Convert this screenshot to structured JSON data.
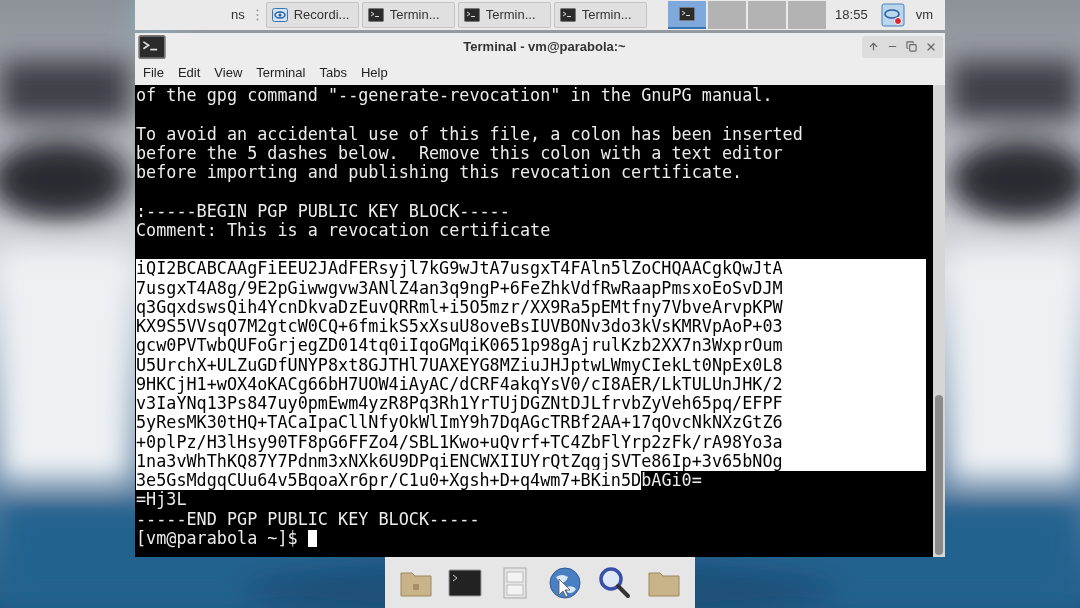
{
  "taskbar": {
    "overflow_label": "ns",
    "tasks": [
      {
        "kind": "recorder",
        "label": "Recordi..."
      },
      {
        "kind": "terminal",
        "label": "Termin..."
      },
      {
        "kind": "terminal",
        "label": "Termin..."
      },
      {
        "kind": "terminal",
        "label": "Termin..."
      }
    ],
    "workspaces": [
      {
        "selected": true
      },
      {
        "selected": false
      },
      {
        "selected": false
      },
      {
        "selected": false
      }
    ],
    "clock": "18:55",
    "user": "vm"
  },
  "window": {
    "title": "Terminal - vm@parabola:~"
  },
  "menu": [
    "File",
    "Edit",
    "View",
    "Terminal",
    "Tabs",
    "Help"
  ],
  "terminal": {
    "lines": [
      {
        "kind": "text",
        "selected": false,
        "text": "of the gpg command \"--generate-revocation\" in the GnuPG manual."
      },
      {
        "kind": "blank"
      },
      {
        "kind": "text",
        "selected": false,
        "text": "To avoid an accidental use of this file, a colon has been inserted"
      },
      {
        "kind": "text",
        "selected": false,
        "text": "before the 5 dashes below.  Remove this colon with a text editor"
      },
      {
        "kind": "text",
        "selected": false,
        "text": "before importing and publishing this revocation certificate."
      },
      {
        "kind": "blank"
      },
      {
        "kind": "text",
        "selected": false,
        "text": ":-----BEGIN PGP PUBLIC KEY BLOCK-----"
      },
      {
        "kind": "text",
        "selected": false,
        "text": "Comment: This is a revocation certificate"
      },
      {
        "kind": "blank"
      },
      {
        "kind": "text",
        "selected": true,
        "text": "iQI2BCABCAAgFiEEU2JAdFERsyjl7kG9wJtA7usgxT4FAln5lZoCHQAACgkQwJtA"
      },
      {
        "kind": "text",
        "selected": true,
        "text": "7usgxT4A8g/9E2pGiwwgvw3ANlZ4an3q9ngP+6FeZhkVdfRwRaapPmsxoEoSvDJM"
      },
      {
        "kind": "text",
        "selected": true,
        "text": "q3GqxdswsQih4YcnDkvaDzEuvQRRml+i5O5mzr/XX9Ra5pEMtfny7VbveArvpKPW"
      },
      {
        "kind": "text",
        "selected": true,
        "text": "KX9S5VVsqO7M2gtcW0CQ+6fmikS5xXsuU8oveBsIUVBONv3do3kVsKMRVpAoP+03"
      },
      {
        "kind": "text",
        "selected": true,
        "text": "gcw0PVTwbQUFoGrjegZD014tq0iIqoGMqiK0651p98gAjrulKzb2XX7n3WxprOum"
      },
      {
        "kind": "text",
        "selected": true,
        "text": "U5UrchX+ULZuGDfUNYP8xt8GJTHl7UAXEYG8MZiuJHJptwLWmyCIekLt0NpEx0L8"
      },
      {
        "kind": "text",
        "selected": true,
        "text": "9HKCjH1+wOX4oKACg66bH7UOW4iAyAC/dCRF4akqYsV0/cI8AER/LkTULUnJHK/2"
      },
      {
        "kind": "text",
        "selected": true,
        "text": "v3IaYNq13Ps847uy0pmEwm4yzR8Pq3Rh1YrTUjDGZNtDJLfrvbZyVeh65pq/EFPF"
      },
      {
        "kind": "text",
        "selected": true,
        "text": "5yResMK30tHQ+TACaIpaCllNfyOkWlImY9h7DqAGcTRBf2AA+17qOvcNkNXzGtZ6"
      },
      {
        "kind": "text",
        "selected": true,
        "text": "+0plPz/H3lHsy90TF8pG6FFZo4/SBL1Kwo+uQvrf+TC4ZbFlYrp2zFk/rA98Yo3a"
      },
      {
        "kind": "text",
        "selected": true,
        "text": "1na3vWhThKQ87Y7Pdnm3xNXk6U9DPqiENCWXIIUYrQtZqgjSVTe86Ip+3v65bNOg"
      },
      {
        "kind": "partial",
        "selected_text": "3e5GsMdgqCUu64v5BqoaXr6pr/C1u0+Xgsh+D+q4wm7+BKin5D",
        "text": "bAGi0="
      },
      {
        "kind": "text",
        "selected": false,
        "text": "=Hj3L"
      },
      {
        "kind": "text",
        "selected": false,
        "text": "-----END PGP PUBLIC KEY BLOCK-----"
      }
    ],
    "prompt": "[vm@parabola ~]$"
  }
}
